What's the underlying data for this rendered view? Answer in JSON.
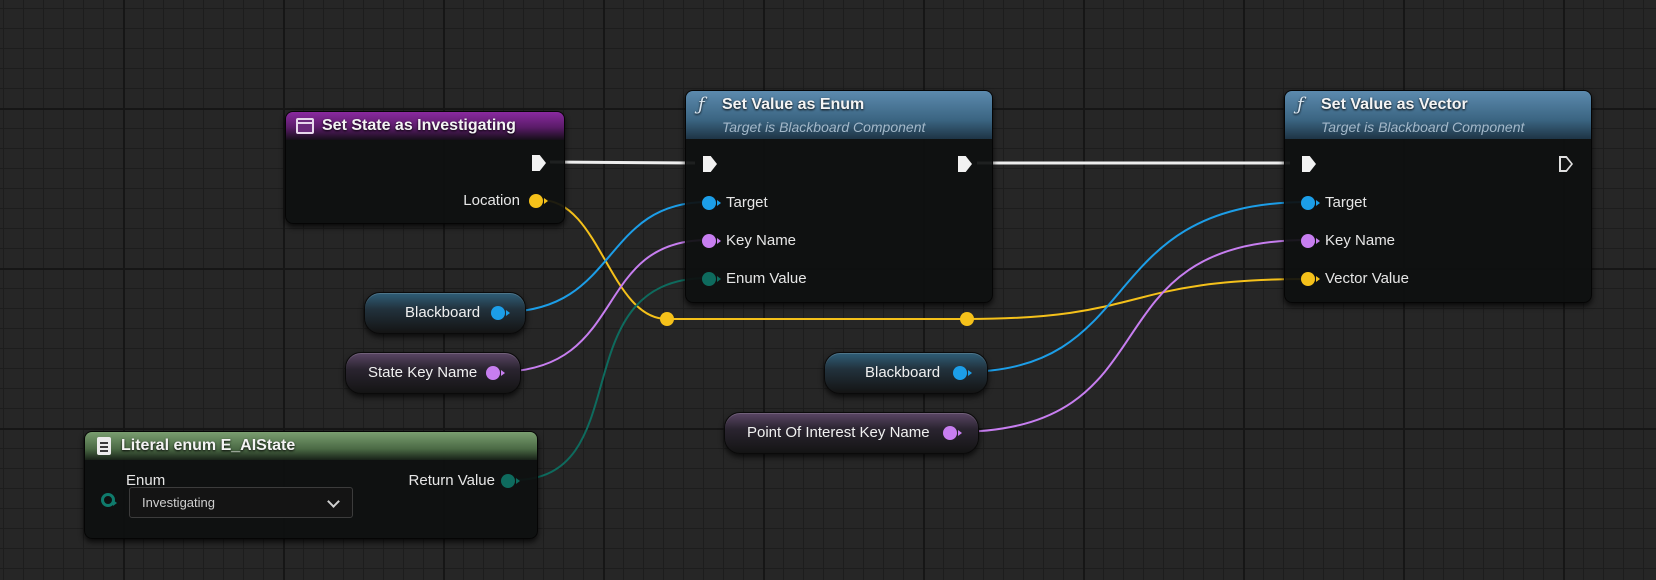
{
  "nodes": {
    "event": {
      "title": "Set State as Investigating",
      "location_label": "Location"
    },
    "set_enum": {
      "title": "Set Value as Enum",
      "subtitle": "Target is Blackboard Component",
      "icon": "function-icon",
      "pins": {
        "target": "Target",
        "key_name": "Key Name",
        "enum_value": "Enum Value"
      }
    },
    "set_vector": {
      "title": "Set Value as Vector",
      "subtitle": "Target is Blackboard Component",
      "icon": "function-icon",
      "pins": {
        "target": "Target",
        "key_name": "Key Name",
        "vector_value": "Vector Value"
      }
    },
    "literal_enum": {
      "title": "Literal enum E_AIState",
      "enum_label": "Enum",
      "return_label": "Return Value",
      "selected": "Investigating"
    }
  },
  "variables": {
    "blackboard_1": "Blackboard",
    "state_key": "State Key Name",
    "blackboard_2": "Blackboard",
    "poi_key": "Point Of Interest Key Name"
  },
  "colors": {
    "object_pin": "#1c9ee8",
    "name_pin": "#c77ef0",
    "vector_pin": "#f5c11a",
    "enum_pin": "#0e6b5e",
    "exec_pin": "#f2f2f2",
    "event_header": "#8a2aa0",
    "function_header": "#4a7596",
    "literal_header": "#6a8f62"
  }
}
